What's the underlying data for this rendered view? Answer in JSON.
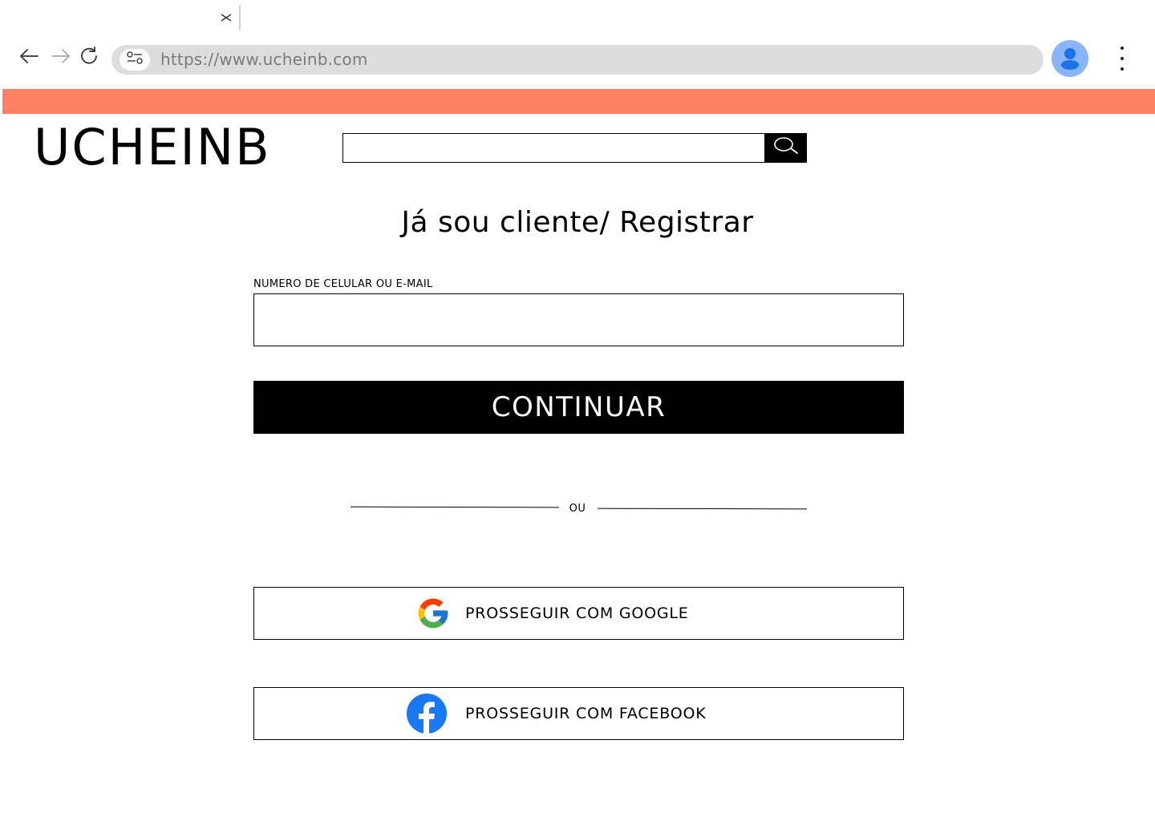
{
  "browser": {
    "url": "https://www.ucheinb.com",
    "icons": {
      "tab_close": "close-icon",
      "back": "arrow-left-icon",
      "forward": "arrow-right-icon",
      "reload": "reload-icon",
      "site_info": "site-settings-icon",
      "profile": "profile-avatar-icon",
      "menu": "more-vertical-icon"
    },
    "colors": {
      "address_bar": "#dddddd",
      "profile": "#8ab4f8"
    }
  },
  "site": {
    "banner_color": "#ff7f62",
    "logo": "UCHEINB",
    "search": {
      "value": "",
      "icon": "search-icon"
    }
  },
  "login": {
    "title": "Já sou cliente/ Registrar",
    "field_label": "NUMERO DE CELULAR OU E-MAIL",
    "field_value": "",
    "continue_label": "CONTINUAR",
    "divider_text": "OU",
    "google_label": "PROSSEGUIR COM GOOGLE",
    "google_icon": "google-icon",
    "facebook_label": "PROSSEGUIR COM FACEBOOK",
    "facebook_icon": "facebook-icon"
  }
}
